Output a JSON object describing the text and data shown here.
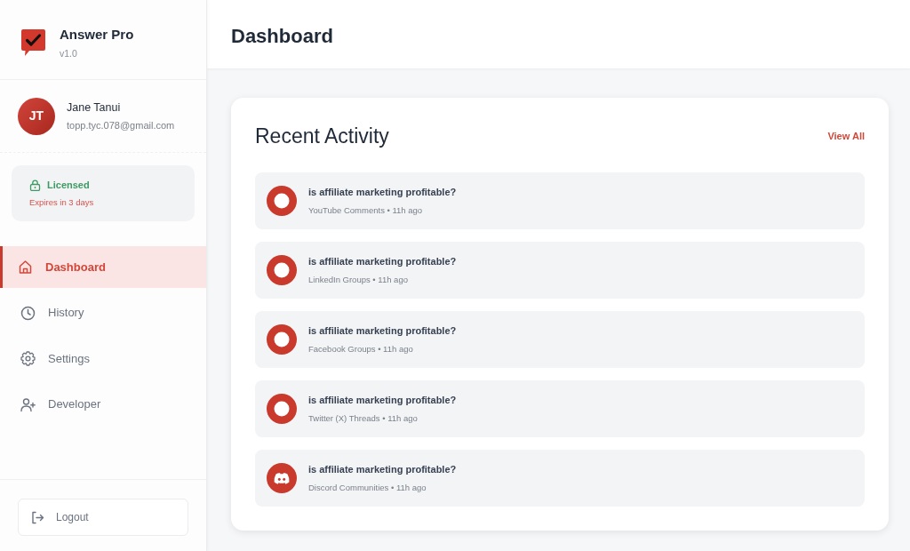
{
  "app": {
    "name": "Answer Pro",
    "version": "v1.0"
  },
  "user": {
    "initials": "JT",
    "name": "Jane Tanui",
    "email": "topp.tyc.078@gmail.com"
  },
  "license": {
    "status": "Licensed",
    "expiry": "Expires in 3 days"
  },
  "sidebar": {
    "items": [
      {
        "label": "Dashboard",
        "selected": true
      },
      {
        "label": "History",
        "selected": false
      },
      {
        "label": "Settings",
        "selected": false
      },
      {
        "label": "Developer",
        "selected": false
      }
    ],
    "logout": "Logout"
  },
  "header": {
    "title": "Dashboard"
  },
  "recent_activity": {
    "title": "Recent Activity",
    "view_all": "View All",
    "items": [
      {
        "kind": "ring",
        "title": "is affiliate marketing profitable?",
        "meta": "YouTube Comments • 11h ago"
      },
      {
        "kind": "ring",
        "title": "is affiliate marketing profitable?",
        "meta": "LinkedIn Groups • 11h ago"
      },
      {
        "kind": "ring",
        "title": "is affiliate marketing profitable?",
        "meta": "Facebook Groups • 11h ago"
      },
      {
        "kind": "ring",
        "title": "is affiliate marketing profitable?",
        "meta": "Twitter (X) Threads • 11h ago"
      },
      {
        "kind": "discord",
        "title": "is affiliate marketing profitable?",
        "meta": "Discord Communities • 11h ago"
      }
    ]
  }
}
